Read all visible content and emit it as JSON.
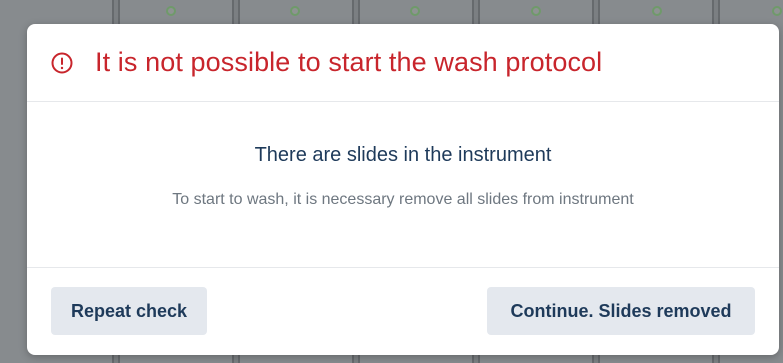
{
  "dialog": {
    "title": "It is not possible to start the wash protocol",
    "title_color": "#c8252c",
    "icon": "alert-circle-icon",
    "heading": "There are slides in the instrument",
    "message": "To start to wash, it is necessary remove all slides from instrument"
  },
  "buttons": {
    "repeat_check": "Repeat check",
    "continue": "Continue. Slides removed"
  }
}
